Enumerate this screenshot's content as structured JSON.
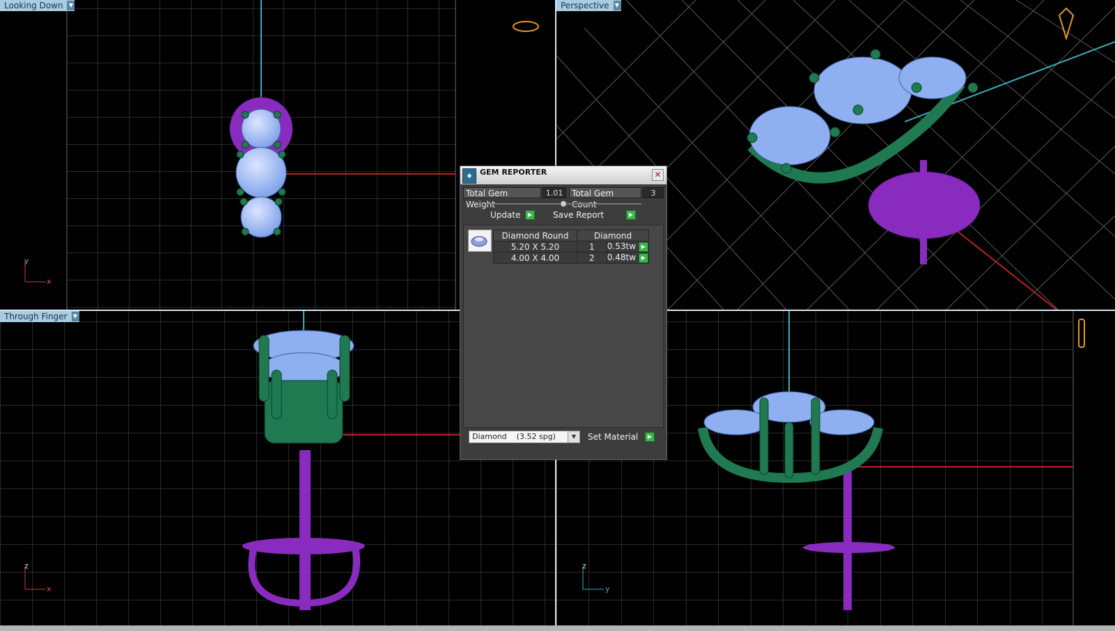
{
  "viewports": {
    "top_left": {
      "label": "Looking Down",
      "axis_v": "y",
      "axis_h": "x"
    },
    "top_right": {
      "label": "Perspective"
    },
    "bottom_left": {
      "label": "Through Finger",
      "axis_v": "z",
      "axis_h": "x"
    },
    "bottom_right": {
      "axis_v": "z",
      "axis_h": "y"
    }
  },
  "dialog": {
    "title": "GEM REPORTER",
    "total_gem_weight_label": "Total Gem Weight",
    "total_gem_weight": "1.01",
    "total_gem_count_label": "Total Gem Count",
    "total_gem_count": "3",
    "update_label": "Update",
    "save_report_label": "Save Report",
    "table": {
      "headers": [
        "Diamond Round",
        "Diamond"
      ],
      "rows": [
        {
          "size": "5.20 X 5.20",
          "count": "1",
          "weight": "0.53tw"
        },
        {
          "size": "4.00 X 4.00",
          "count": "2",
          "weight": "0.48tw"
        }
      ]
    },
    "material_select": "Diamond    (3.52 spg)",
    "set_material_label": "Set Material"
  },
  "colors": {
    "grid": "#5a5a5a",
    "metal_green": "#1f7a52",
    "metal_purple": "#8a2bc0",
    "gem_blue": "#8fb0f0",
    "axis_red": "#c02020",
    "axis_cyan": "#3ab0c0",
    "label_bg": "#a9cde0"
  }
}
